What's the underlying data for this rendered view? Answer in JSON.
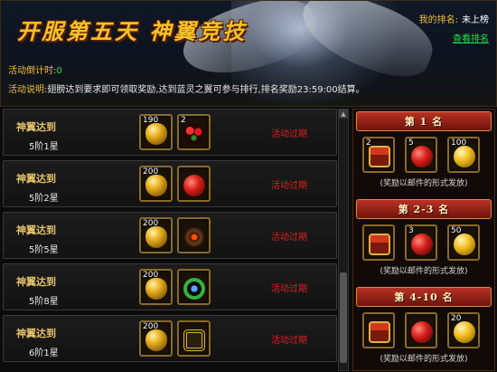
{
  "header": {
    "title": "开服第五天  神翼竞技",
    "rank_label": "我的排名:",
    "rank_value": "未上榜",
    "rank_link": "查看排名",
    "countdown_label": "活动倒计时:",
    "countdown_value": "0",
    "desc_label": "活动说明:",
    "desc_text": "翅膀达到要求即可领取奖励,达到蓝灵之翼可参与排行,排名奖励23:59:00结算。"
  },
  "tasks": [
    {
      "name": "神翼达到",
      "star": "5阶1星",
      "item1": {
        "count": "190",
        "icon": "gold-egg-icon"
      },
      "item2": {
        "count": "2",
        "icon": "roses-icon"
      },
      "status": "活动过期"
    },
    {
      "name": "神翼达到",
      "star": "5阶2星",
      "item1": {
        "count": "200",
        "icon": "gold-egg-icon"
      },
      "item2": {
        "count": "",
        "icon": "apple-icon"
      },
      "status": "活动过期"
    },
    {
      "name": "神翼达到",
      "star": "5阶5星",
      "item1": {
        "count": "200",
        "icon": "gold-egg-icon"
      },
      "item2": {
        "count": "",
        "icon": "amulet-icon"
      },
      "status": "活动过期"
    },
    {
      "name": "神翼达到",
      "star": "5阶8星",
      "item1": {
        "count": "200",
        "icon": "gold-egg-icon"
      },
      "item2": {
        "count": "",
        "icon": "ring-icon"
      },
      "status": "活动过期"
    },
    {
      "name": "神翼达到",
      "star": "6阶1星",
      "item1": {
        "count": "200",
        "icon": "gold-egg-icon"
      },
      "item2": {
        "count": "",
        "icon": "bracelet-icon"
      },
      "status": "活动过期"
    }
  ],
  "rewards": [
    {
      "title": "第 1 名",
      "items": [
        {
          "count": "2",
          "icon": "chest-icon"
        },
        {
          "count": "5",
          "icon": "apple-icon"
        },
        {
          "count": "100",
          "icon": "gold-ball-icon"
        }
      ],
      "note": "(奖励以邮件的形式发放)"
    },
    {
      "title": "第 2-3 名",
      "items": [
        {
          "count": "",
          "icon": "chest-icon"
        },
        {
          "count": "3",
          "icon": "apple-icon"
        },
        {
          "count": "50",
          "icon": "gold-ball-icon"
        }
      ],
      "note": "(奖励以邮件的形式发放)"
    },
    {
      "title": "第 4-10 名",
      "items": [
        {
          "count": "",
          "icon": "chest-icon"
        },
        {
          "count": "",
          "icon": "apple-icon"
        },
        {
          "count": "20",
          "icon": "gold-ball-icon"
        }
      ],
      "note": "(奖励以邮件的形式发放)"
    }
  ]
}
